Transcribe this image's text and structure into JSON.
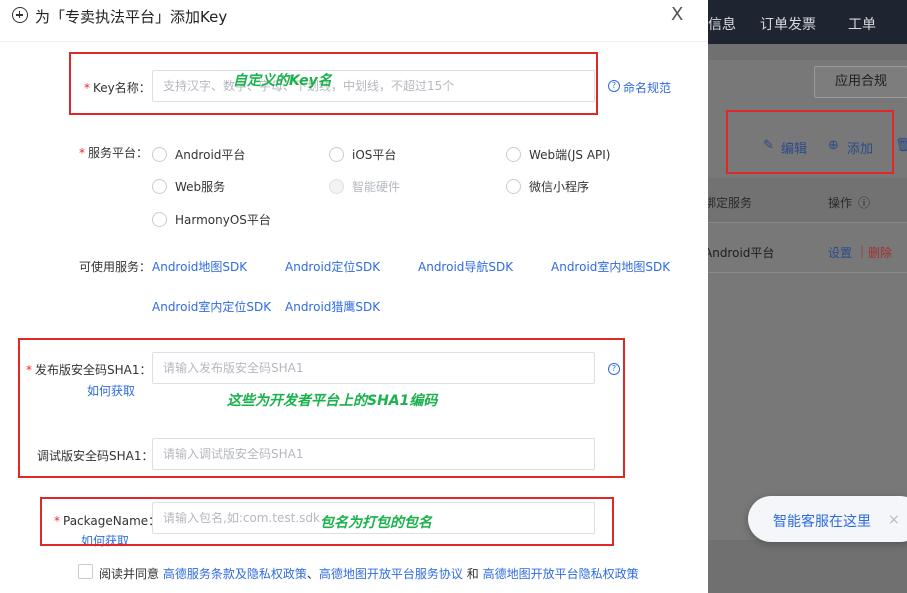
{
  "background": {
    "nav": [
      "信息",
      "订单发票",
      "工单"
    ],
    "apply_button": "应用合规",
    "edit_label": "编辑",
    "add_label": "添加",
    "table_header_service": "绑定服务",
    "table_header_ops": "操作",
    "row_platform": "Android平台",
    "row_settings": "设置",
    "row_delete": "删除"
  },
  "chat": {
    "text": "智能客服在这里",
    "close": "×"
  },
  "dialog": {
    "title": "为「专卖执法平台」添加Key",
    "close": "X",
    "key_name": {
      "required": "*",
      "label": "Key名称：",
      "placeholder": "支持汉字、数字、字母、下划线，中划线，不超过15个",
      "help_link": "命名规范"
    },
    "service_platform": {
      "required": "*",
      "label": "服务平台：",
      "options": [
        "Android平台",
        "iOS平台",
        "Web端(JS API)",
        "Web服务",
        "智能硬件",
        "微信小程序",
        "HarmonyOS平台"
      ]
    },
    "available_services": {
      "label": "可使用服务：",
      "items": [
        "Android地图SDK",
        "Android定位SDK",
        "Android导航SDK",
        "Android室内地图SDK",
        "Android室内定位SDK",
        "Android猎鹰SDK"
      ]
    },
    "release_sha1": {
      "required": "*",
      "label": "发布版安全码SHA1：",
      "placeholder": "请输入发布版安全码SHA1",
      "how_link": "如何获取"
    },
    "debug_sha1": {
      "label": "调试版安全码SHA1：",
      "placeholder": "请输入调试版安全码SHA1"
    },
    "package_name": {
      "required": "*",
      "label": "PackageName：",
      "placeholder": "请输入包名,如:com.test.sdk",
      "how_link": "如何获取"
    },
    "agreement": {
      "prefix": "阅读并同意",
      "link1": "高德服务条款及隐私权政策",
      "sep1": "、",
      "link2": "高德地图开放平台服务协议",
      "sep2": "和",
      "link3": "高德地图开放平台隐私权政策"
    }
  },
  "annotations": {
    "key_note": "自定义的Key名",
    "sha1_note": "这些为开发者平台上的SHA1编码",
    "package_note": "包名为打包的包名"
  },
  "colors": {
    "accent": "#2f6be0",
    "required": "#f5222d",
    "annotation_box": "#e02828",
    "annotation_text": "#19b24b"
  }
}
